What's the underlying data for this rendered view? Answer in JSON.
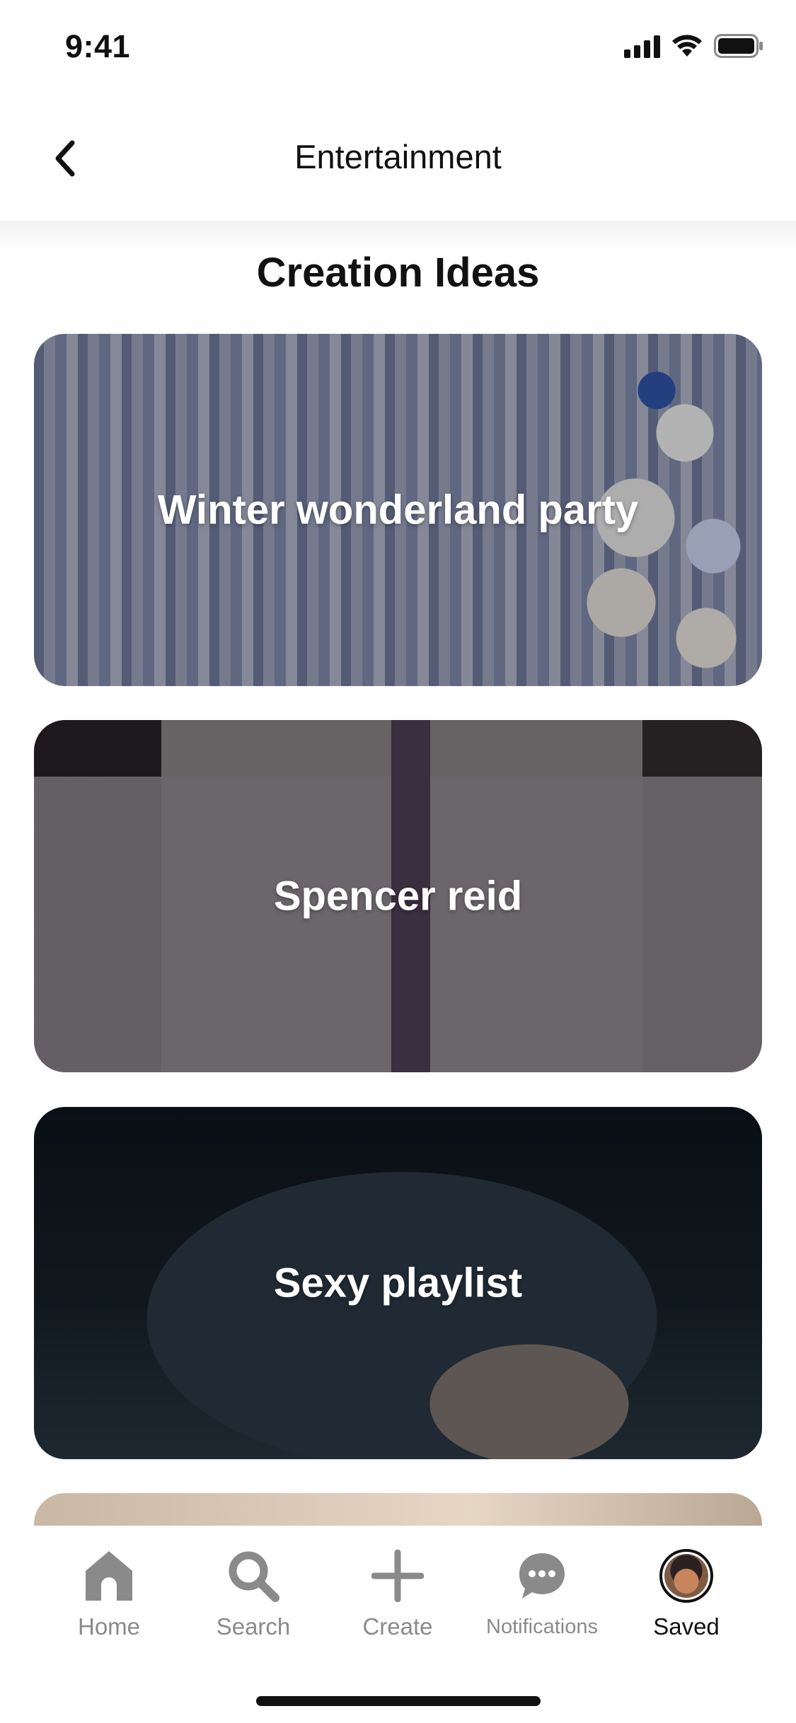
{
  "status_bar": {
    "time": "9:41",
    "icons": [
      "cellular-signal-icon",
      "wifi-icon",
      "battery-icon"
    ]
  },
  "header": {
    "back_icon": "chevron-left-icon",
    "title": "Entertainment"
  },
  "section": {
    "title": "Creation Ideas",
    "cards": [
      {
        "label": "Winter wonderland party"
      },
      {
        "label": "Spencer reid"
      },
      {
        "label": "Sexy playlist"
      }
    ]
  },
  "bottom_nav": {
    "items": [
      {
        "label": "Home",
        "icon": "home-icon"
      },
      {
        "label": "Search",
        "icon": "search-icon"
      },
      {
        "label": "Create",
        "icon": "plus-icon"
      },
      {
        "label": "Notifications",
        "icon": "chat-bubble-icon"
      },
      {
        "label": "Saved",
        "icon": "avatar",
        "active": true
      }
    ]
  },
  "colors": {
    "text_primary": "#111111",
    "text_secondary": "#8a8a8a",
    "background": "#ffffff"
  }
}
